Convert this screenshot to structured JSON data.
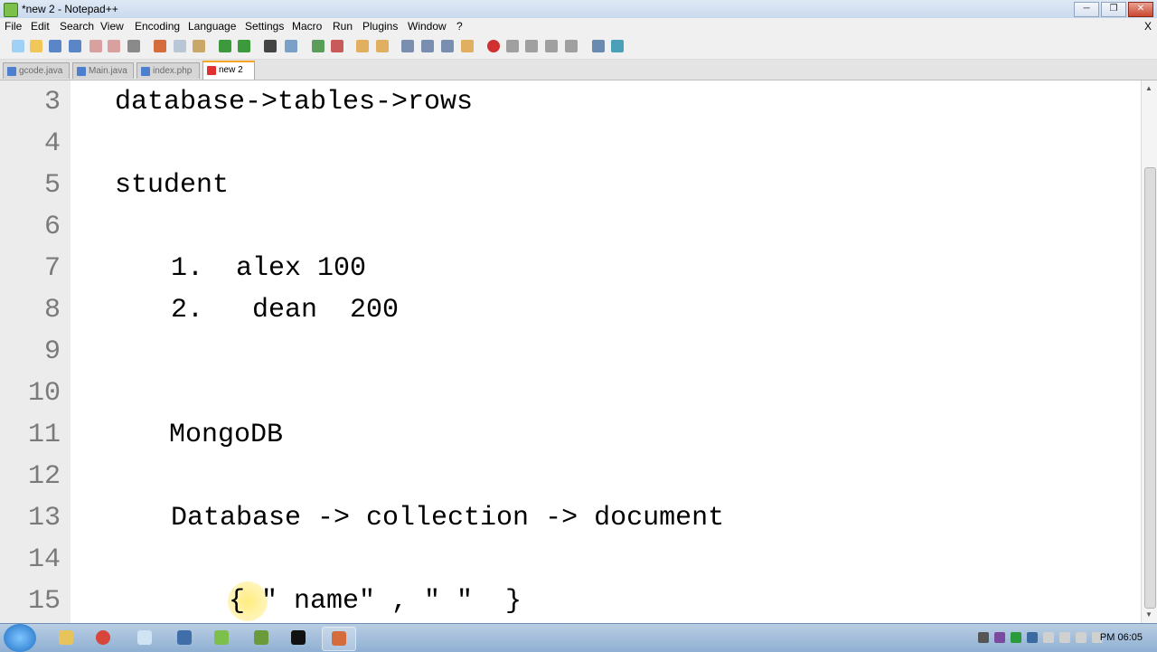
{
  "window": {
    "title": "*new 2 - Notepad++",
    "close_label": "X"
  },
  "menu": [
    "File",
    "Edit",
    "Search",
    "View",
    "Encoding",
    "Language",
    "Settings",
    "Macro",
    "Run",
    "Plugins",
    "Window",
    "?"
  ],
  "tabs": [
    {
      "label": "gcode.java",
      "active": false
    },
    {
      "label": "Main.java",
      "active": false
    },
    {
      "label": "index.php",
      "active": false
    },
    {
      "label": "new 2",
      "active": true
    }
  ],
  "editor": {
    "lines": [
      {
        "num": "3",
        "text": "database->tables->rows"
      },
      {
        "num": "4",
        "text": ""
      },
      {
        "num": "5",
        "text": "student"
      },
      {
        "num": "6",
        "text": ""
      },
      {
        "num": "7",
        "text": "1.  alex 100"
      },
      {
        "num": "8",
        "text": "2.   dean  200"
      },
      {
        "num": "9",
        "text": ""
      },
      {
        "num": "10",
        "text": ""
      },
      {
        "num": "11",
        "text": "MongoDB"
      },
      {
        "num": "12",
        "text": ""
      },
      {
        "num": "13",
        "text": "Database -> collection -> document"
      },
      {
        "num": "14",
        "text": ""
      },
      {
        "num": "15",
        "text": "{ \" name\" , \" \"  }"
      }
    ]
  },
  "taskbar": {
    "clock": "PM 06:05"
  },
  "colors": {
    "active_tab_accent": "#f5a623",
    "gutter": "#ececec",
    "line_number": "#7a7a7a"
  }
}
